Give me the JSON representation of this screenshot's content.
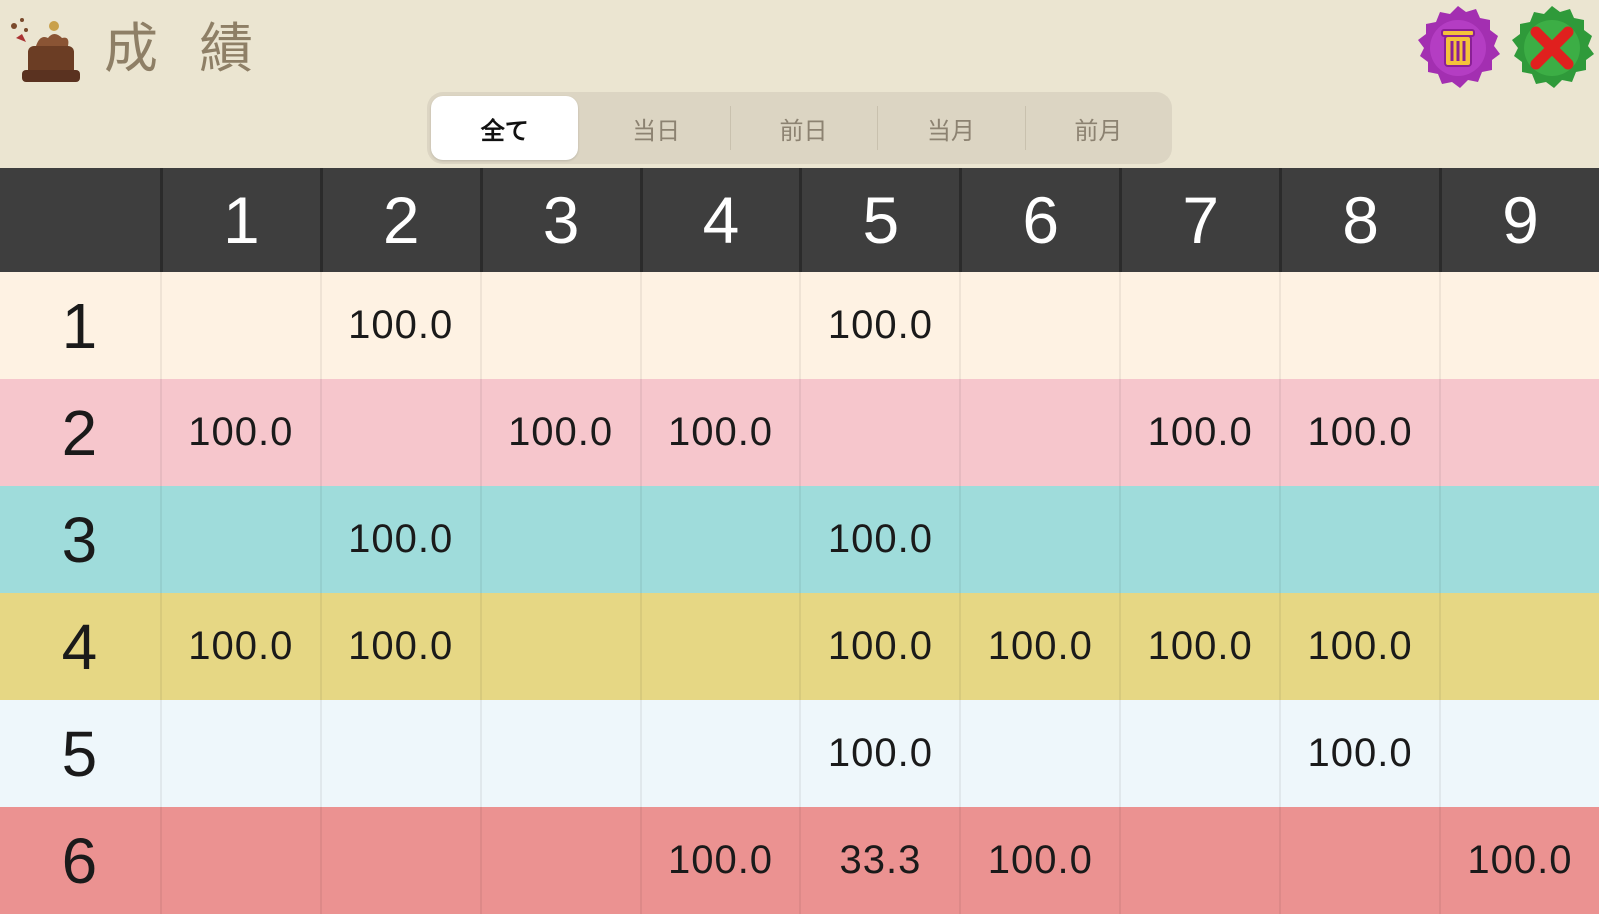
{
  "header": {
    "title": "成 績",
    "trash_icon": "trash-icon",
    "close_icon": "close-icon"
  },
  "tabs": [
    {
      "label": "全て",
      "active": true
    },
    {
      "label": "当日",
      "active": false
    },
    {
      "label": "前日",
      "active": false
    },
    {
      "label": "当月",
      "active": false
    },
    {
      "label": "前月",
      "active": false
    }
  ],
  "table": {
    "columns": [
      "",
      "1",
      "2",
      "3",
      "4",
      "5",
      "6",
      "7",
      "8",
      "9"
    ],
    "rows": [
      {
        "label": "1",
        "color": "#fef2e3",
        "cells": [
          "",
          "100.0",
          "",
          "",
          "100.0",
          "",
          "",
          "",
          ""
        ]
      },
      {
        "label": "2",
        "color": "#f6c6cc",
        "cells": [
          "100.0",
          "",
          "100.0",
          "100.0",
          "",
          "",
          "100.0",
          "100.0",
          ""
        ]
      },
      {
        "label": "3",
        "color": "#9fdcdb",
        "cells": [
          "",
          "100.0",
          "",
          "",
          "100.0",
          "",
          "",
          "",
          ""
        ]
      },
      {
        "label": "4",
        "color": "#e6d784",
        "cells": [
          "100.0",
          "100.0",
          "",
          "",
          "100.0",
          "100.0",
          "100.0",
          "100.0",
          ""
        ]
      },
      {
        "label": "5",
        "color": "#eef7fb",
        "cells": [
          "",
          "",
          "",
          "",
          "100.0",
          "",
          "",
          "100.0",
          ""
        ]
      },
      {
        "label": "6",
        "color": "#eb9291",
        "cells": [
          "",
          "",
          "",
          "100.0",
          "33.3",
          "100.0",
          "",
          "",
          "100.0"
        ]
      }
    ]
  }
}
